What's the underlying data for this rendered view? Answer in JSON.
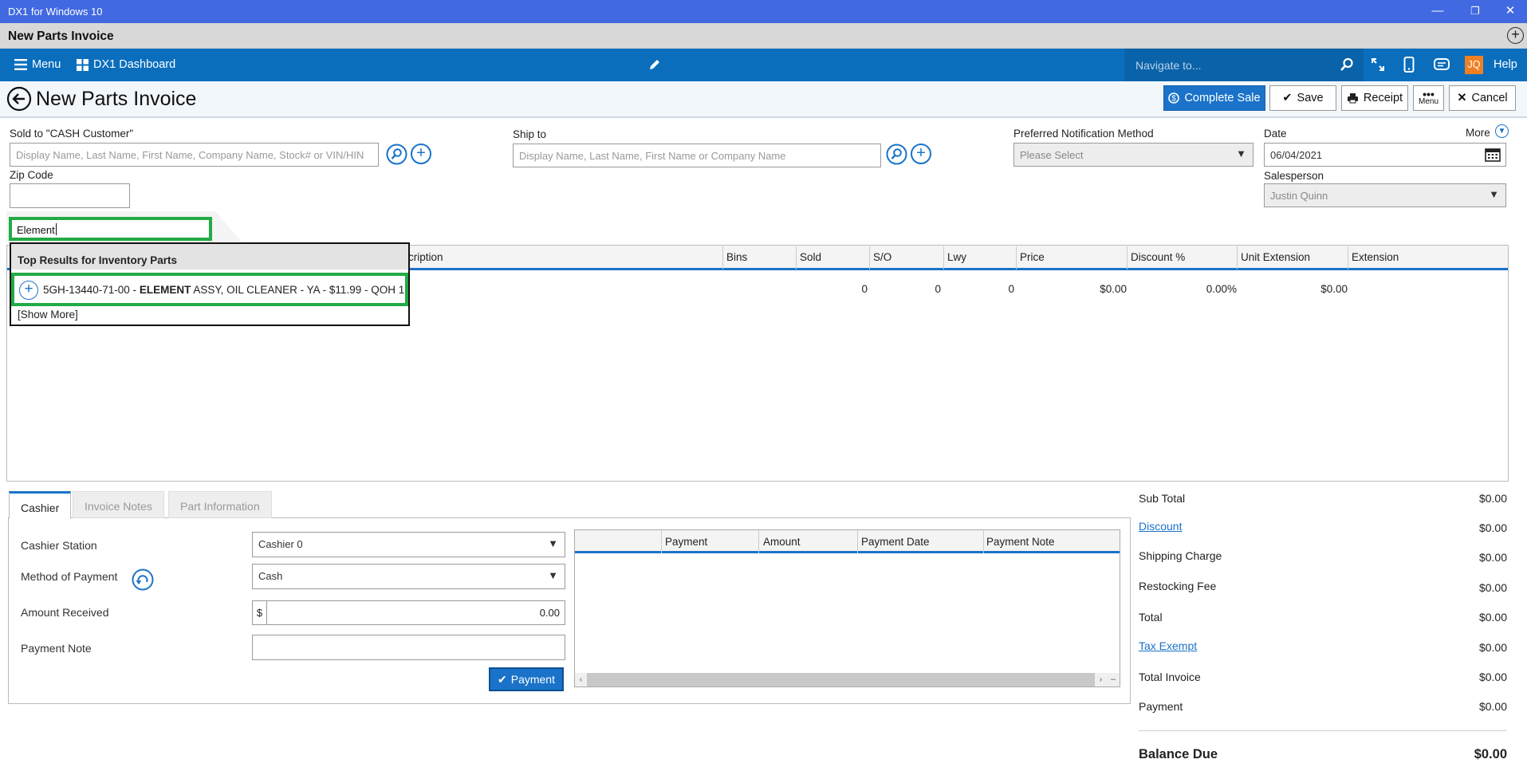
{
  "window": {
    "title": "DX1 for Windows 10",
    "minimize": "—",
    "restore": "❐",
    "close": "✕"
  },
  "doc_tab": {
    "title": "New Parts Invoice",
    "add": "+"
  },
  "appbar": {
    "menu": "Menu",
    "dashboard": "DX1 Dashboard",
    "navigate_placeholder": "Navigate to...",
    "user_initials": "JQ",
    "help": "Help"
  },
  "page": {
    "title": "New Parts Invoice",
    "actions": {
      "complete_sale": "Complete Sale",
      "save": "Save",
      "receipt": "Receipt",
      "menu": "Menu",
      "cancel": "Cancel"
    }
  },
  "form": {
    "sold_to_label": "Sold to  \"CASH Customer\"",
    "sold_to_placeholder": "Display Name, Last Name, First Name, Company Name, Stock# or VIN/HIN",
    "ship_to_label": "Ship to",
    "ship_to_placeholder": "Display Name, Last Name, First Name or Company Name",
    "notification_label": "Preferred Notification Method",
    "notification_value": "Please Select",
    "date_label": "Date",
    "date_value": "06/04/2021",
    "more_label": "More",
    "zip_label": "Zip Code",
    "zip_value": "",
    "salesperson_label": "Salesperson",
    "salesperson_value": "Justin Quinn"
  },
  "part_search": {
    "value": "Element",
    "results_header": "Top Results for Inventory Parts",
    "result": {
      "part_no": "5GH-13440-71-00 - ",
      "keyword": "ELEMENT",
      "rest": " ASSY, OIL CLEANER - YA - $11.99 - QOH 1"
    },
    "show_more": "[Show More]"
  },
  "grid": {
    "columns": [
      "cription",
      "Bins",
      "Sold",
      "S/O",
      "Lwy",
      "Price",
      "Discount %",
      "Unit Extension",
      "Extension"
    ],
    "row": {
      "sold": "0",
      "so": "0",
      "lwy": "0",
      "price": "$0.00",
      "discount": "0.00%",
      "unit_ext": "$0.00"
    }
  },
  "tabs": [
    "Cashier",
    "Invoice Notes",
    "Part Information"
  ],
  "cashier": {
    "station_label": "Cashier Station",
    "station_value": "Cashier 0",
    "method_label": "Method of Payment",
    "method_value": "Cash",
    "amount_label": "Amount Received",
    "currency": "$",
    "amount_value": "0.00",
    "note_label": "Payment Note",
    "note_value": "",
    "payment_button": "Payment"
  },
  "payments_grid": {
    "columns": [
      "Payment",
      "Amount",
      "Payment Date",
      "Payment Note"
    ]
  },
  "summary": [
    {
      "label": "Sub Total",
      "value": "$0.00",
      "link": false
    },
    {
      "label": "Discount",
      "value": "$0.00",
      "link": true
    },
    {
      "label": "Shipping Charge",
      "value": "$0.00",
      "link": false
    },
    {
      "label": "Restocking Fee",
      "value": "$0.00",
      "link": false
    },
    {
      "label": "Total",
      "value": "$0.00",
      "link": false
    },
    {
      "label": "Tax Exempt",
      "value": "$0.00",
      "link": true
    },
    {
      "label": "Total Invoice",
      "value": "$0.00",
      "link": false
    },
    {
      "label": "Payment",
      "value": "$0.00",
      "link": false
    }
  ],
  "balance": {
    "label": "Balance Due",
    "value": "$0.00"
  },
  "colors": {
    "titlebar": "#4169e1",
    "appbar": "#0a6ebd",
    "accent": "#1a73c9",
    "highlight": "#22aa44",
    "user": "#f07f22"
  }
}
